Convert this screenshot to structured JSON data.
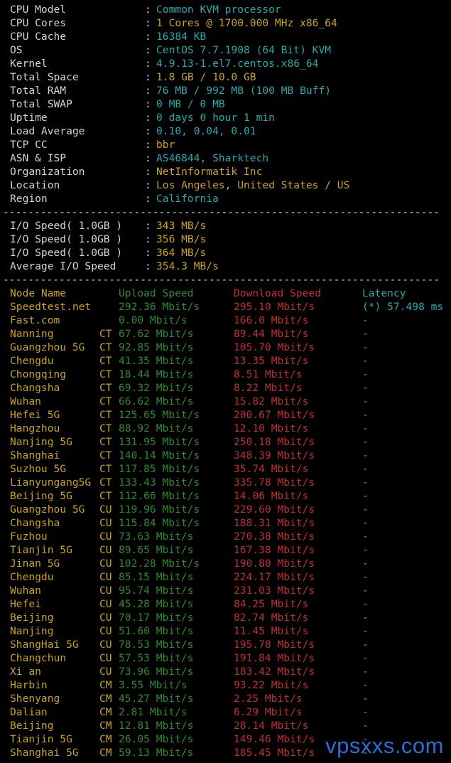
{
  "sysinfo": [
    {
      "label": "CPU Model",
      "value": "Common KVM processor"
    },
    {
      "label": "CPU Cores",
      "value": "1 Cores @ 1700.000 MHz x86_64"
    },
    {
      "label": "CPU Cache",
      "value": "16384 KB"
    },
    {
      "label": "OS",
      "value": "CentOS 7.7.1908 (64 Bit) KVM"
    },
    {
      "label": "Kernel",
      "value": "4.9.13-1.el7.centos.x86_64"
    },
    {
      "label": "Total Space",
      "value": "1.8 GB / 10.0 GB"
    },
    {
      "label": "Total RAM",
      "value": "76 MB / 992 MB (100 MB Buff)"
    },
    {
      "label": "Total SWAP",
      "value": "0 MB / 0 MB"
    },
    {
      "label": "Uptime",
      "value": "0 days 0 hour 1 min"
    },
    {
      "label": "Load Average",
      "value": "0.10, 0.04, 0.01"
    },
    {
      "label": "TCP CC",
      "value": "bbr"
    },
    {
      "label": "ASN & ISP",
      "value": "AS46844, Sharktech"
    },
    {
      "label": "Organization",
      "value": "NetInformatik Inc"
    },
    {
      "label": "Location",
      "value": "Los Angeles, United States / US"
    },
    {
      "label": "Region",
      "value": "California"
    }
  ],
  "colon": ":",
  "separator": "----------------------------------------------------------------------",
  "io": [
    {
      "label": "I/O Speed( 1.0GB )",
      "value": "343 MB/s"
    },
    {
      "label": "I/O Speed( 1.0GB )",
      "value": "356 MB/s"
    },
    {
      "label": "I/O Speed( 1.0GB )",
      "value": "364 MB/s"
    },
    {
      "label": "Average I/O Speed",
      "value": "354.3 MB/s"
    }
  ],
  "speed_header": {
    "node": "Node Name",
    "upload": "Upload Speed",
    "download": "Download Speed",
    "latency": "Latency"
  },
  "speed_rows": [
    {
      "node": "Speedtest.net",
      "isp": "",
      "up": "292.36 Mbit/s",
      "down": "295.10 Mbit/s",
      "lat": "(*) 57.498 ms"
    },
    {
      "node": "Fast.com",
      "isp": "",
      "up": "0.00 Mbit/s",
      "down": "166.0 Mbit/s",
      "lat": "-"
    },
    {
      "node": "Nanning",
      "isp": "CT",
      "up": "67.62 Mbit/s",
      "down": "89.44 Mbit/s",
      "lat": "-"
    },
    {
      "node": "Guangzhou 5G",
      "isp": "CT",
      "up": "92.85 Mbit/s",
      "down": "105.70 Mbit/s",
      "lat": "-"
    },
    {
      "node": "Chengdu",
      "isp": "CT",
      "up": "41.35 Mbit/s",
      "down": "13.35 Mbit/s",
      "lat": "-"
    },
    {
      "node": "Chongqing",
      "isp": "CT",
      "up": "18.44 Mbit/s",
      "down": "8.51 Mbit/s",
      "lat": "-"
    },
    {
      "node": "Changsha",
      "isp": "CT",
      "up": "69.32 Mbit/s",
      "down": "8.22 Mbit/s",
      "lat": "-"
    },
    {
      "node": "Wuhan",
      "isp": "CT",
      "up": "66.62 Mbit/s",
      "down": "15.82 Mbit/s",
      "lat": "-"
    },
    {
      "node": "Hefei 5G",
      "isp": "CT",
      "up": "125.65 Mbit/s",
      "down": "200.67 Mbit/s",
      "lat": "-"
    },
    {
      "node": "Hangzhou",
      "isp": "CT",
      "up": "88.92 Mbit/s",
      "down": "12.10 Mbit/s",
      "lat": "-"
    },
    {
      "node": "Nanjing 5G",
      "isp": "CT",
      "up": "131.95 Mbit/s",
      "down": "250.18 Mbit/s",
      "lat": "-"
    },
    {
      "node": "Shanghai",
      "isp": "CT",
      "up": "140.14 Mbit/s",
      "down": "348.39 Mbit/s",
      "lat": "-"
    },
    {
      "node": "Suzhou 5G",
      "isp": "CT",
      "up": "117.85 Mbit/s",
      "down": "35.74 Mbit/s",
      "lat": "-"
    },
    {
      "node": "Lianyungang5G",
      "isp": "CT",
      "up": "133.43 Mbit/s",
      "down": "335.78 Mbit/s",
      "lat": "-"
    },
    {
      "node": "Beijing 5G",
      "isp": "CT",
      "up": "112.66 Mbit/s",
      "down": "14.06 Mbit/s",
      "lat": "-"
    },
    {
      "node": "Guangzhou 5G",
      "isp": "CU",
      "up": "119.96 Mbit/s",
      "down": "229.60 Mbit/s",
      "lat": "-"
    },
    {
      "node": "Changsha",
      "isp": "CU",
      "up": "115.84 Mbit/s",
      "down": "188.31 Mbit/s",
      "lat": "-"
    },
    {
      "node": "Fuzhou",
      "isp": "CU",
      "up": "73.63 Mbit/s",
      "down": "270.38 Mbit/s",
      "lat": "-"
    },
    {
      "node": "Tianjin 5G",
      "isp": "CU",
      "up": "89.65 Mbit/s",
      "down": "167.38 Mbit/s",
      "lat": "-"
    },
    {
      "node": "Jinan 5G",
      "isp": "CU",
      "up": "102.28 Mbit/s",
      "down": "190.80 Mbit/s",
      "lat": "-"
    },
    {
      "node": "Chengdu",
      "isp": "CU",
      "up": "85.15 Mbit/s",
      "down": "224.17 Mbit/s",
      "lat": "-"
    },
    {
      "node": "Wuhan",
      "isp": "CU",
      "up": "95.74 Mbit/s",
      "down": "231.03 Mbit/s",
      "lat": "-"
    },
    {
      "node": "Hefei",
      "isp": "CU",
      "up": "45.28 Mbit/s",
      "down": "84.25 Mbit/s",
      "lat": "-"
    },
    {
      "node": "Beijing",
      "isp": "CU",
      "up": "70.17 Mbit/s",
      "down": "82.74 Mbit/s",
      "lat": "-"
    },
    {
      "node": "Nanjing",
      "isp": "CU",
      "up": "51.60 Mbit/s",
      "down": "11.45 Mbit/s",
      "lat": "-"
    },
    {
      "node": "ShangHai 5G",
      "isp": "CU",
      "up": "78.53 Mbit/s",
      "down": "195.78 Mbit/s",
      "lat": "-"
    },
    {
      "node": "Changchun",
      "isp": "CU",
      "up": "57.53 Mbit/s",
      "down": "191.84 Mbit/s",
      "lat": "-"
    },
    {
      "node": "Xi an",
      "isp": "CU",
      "up": "73.96 Mbit/s",
      "down": "183.42 Mbit/s",
      "lat": "-"
    },
    {
      "node": "Harbin",
      "isp": "CM",
      "up": "3.55 Mbit/s",
      "down": "93.22 Mbit/s",
      "lat": "-"
    },
    {
      "node": "Shenyang",
      "isp": "CM",
      "up": "45.27 Mbit/s",
      "down": "2.25 Mbit/s",
      "lat": "-"
    },
    {
      "node": "Dalian",
      "isp": "CM",
      "up": "2.81 Mbit/s",
      "down": "6.29 Mbit/s",
      "lat": "-"
    },
    {
      "node": "Beijing",
      "isp": "CM",
      "up": "12.81 Mbit/s",
      "down": "28.14 Mbit/s",
      "lat": "-"
    },
    {
      "node": "Tianjin 5G",
      "isp": "CM",
      "up": "26.05 Mbit/s",
      "down": "149.46 Mbit/s",
      "lat": "-"
    },
    {
      "node": "Shanghai 5G",
      "isp": "CM",
      "up": "59.13 Mbit/s",
      "down": "185.45 Mbit/s",
      "lat": "-"
    }
  ],
  "watermark": "vpsxxs.com",
  "colors": {
    "label": "#d4d4d4",
    "cyan": "#2aa9a9",
    "yellow": "#c9a227",
    "green": "#2e8b2e",
    "red": "#c0302e",
    "watermark": "#2b6fd6"
  }
}
